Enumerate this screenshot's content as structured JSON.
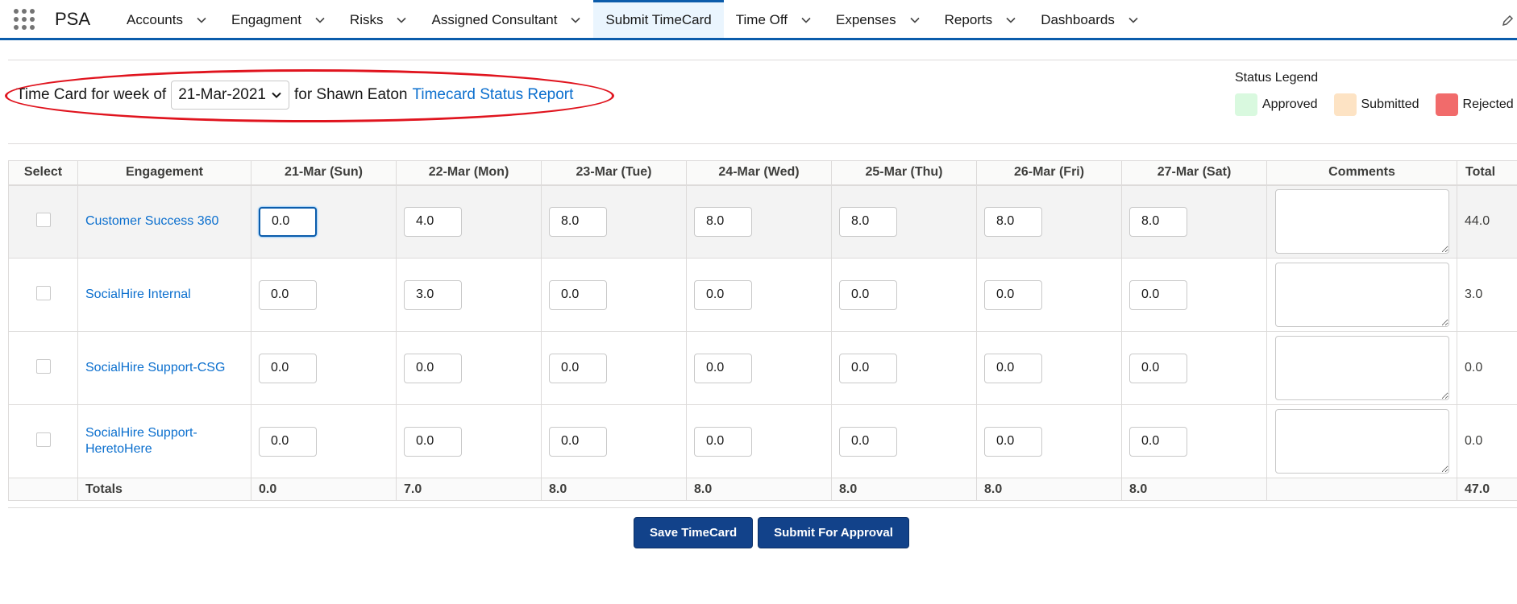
{
  "app": {
    "name": "PSA"
  },
  "nav": {
    "items": [
      {
        "label": "Accounts",
        "active": false
      },
      {
        "label": "Engagment",
        "active": false
      },
      {
        "label": "Risks",
        "active": false
      },
      {
        "label": "Assigned Consultant",
        "active": false
      },
      {
        "label": "Submit TimeCard",
        "active": true
      },
      {
        "label": "Time Off",
        "active": false
      },
      {
        "label": "Expenses",
        "active": false
      },
      {
        "label": "Reports",
        "active": false
      },
      {
        "label": "Dashboards",
        "active": false
      }
    ]
  },
  "header": {
    "prefix": "Time Card for week of",
    "week_value": "21-Mar-2021",
    "for_text": "for Shawn Eaton",
    "report_link": "Timecard Status Report"
  },
  "legend": {
    "title": "Status Legend",
    "items": [
      {
        "label": "Approved",
        "color": "#d9f9df"
      },
      {
        "label": "Submitted",
        "color": "#fde3c4"
      },
      {
        "label": "Rejected",
        "color": "#f16b6b"
      }
    ]
  },
  "table": {
    "headers": {
      "select": "Select",
      "engagement": "Engagement",
      "days": [
        "21-Mar (Sun)",
        "22-Mar (Mon)",
        "23-Mar (Tue)",
        "24-Mar (Wed)",
        "25-Mar (Thu)",
        "26-Mar (Fri)",
        "27-Mar (Sat)"
      ],
      "comments": "Comments",
      "total": "Total"
    },
    "rows": [
      {
        "engagement": "Customer Success 360",
        "hours": [
          "0.0",
          "4.0",
          "8.0",
          "8.0",
          "8.0",
          "8.0",
          "8.0"
        ],
        "total": "44.0"
      },
      {
        "engagement": "SocialHire Internal",
        "hours": [
          "0.0",
          "3.0",
          "0.0",
          "0.0",
          "0.0",
          "0.0",
          "0.0"
        ],
        "total": "3.0"
      },
      {
        "engagement": "SocialHire Support-CSG",
        "hours": [
          "0.0",
          "0.0",
          "0.0",
          "0.0",
          "0.0",
          "0.0",
          "0.0"
        ],
        "total": "0.0"
      },
      {
        "engagement": "SocialHire Support-HeretoHere",
        "hours": [
          "0.0",
          "0.0",
          "0.0",
          "0.0",
          "0.0",
          "0.0",
          "0.0"
        ],
        "total": "0.0"
      }
    ],
    "totals": {
      "label": "Totals",
      "days": [
        "0.0",
        "7.0",
        "8.0",
        "8.0",
        "8.0",
        "8.0",
        "8.0"
      ],
      "grand": "47.0"
    }
  },
  "buttons": {
    "save": "Save TimeCard",
    "submit": "Submit For Approval"
  },
  "colors": {
    "brand": "#0b5cab",
    "link": "#0b6fce",
    "button": "#12428a",
    "annotation": "#e0141e"
  }
}
